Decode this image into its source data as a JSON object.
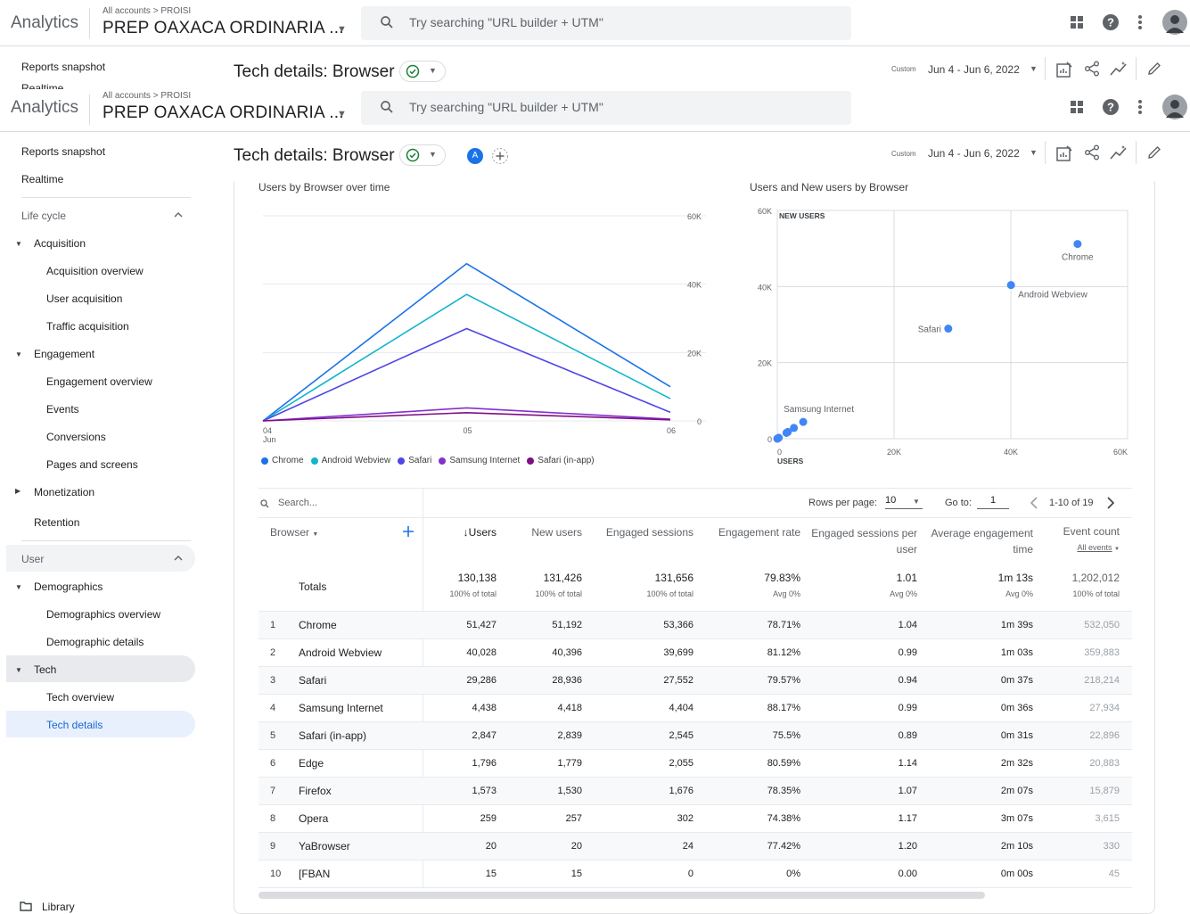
{
  "header": {
    "logo": "Analytics",
    "breadcrumb": "All accounts > PROISI",
    "property": "PREP OAXACA ORDINARIA ...",
    "search_placeholder": "Try searching \"URL builder + UTM\""
  },
  "icons": [
    "search-icon",
    "apps-grid-icon",
    "help-icon",
    "more-vert-icon",
    "avatar",
    "customize-report-icon",
    "share-icon",
    "insights-icon",
    "edit-icon",
    "check-circle-icon",
    "folder-icon"
  ],
  "sidebar_partial_label": "Realtime",
  "toolbar": {
    "title": "Tech details: Browser",
    "custom_label": "Custom",
    "date_range": "Jun 4 - Jun 6, 2022",
    "comparison_badge": "A"
  },
  "sidebar": {
    "reports_snapshot": "Reports snapshot",
    "realtime": "Realtime",
    "life_cycle": "Life cycle",
    "acquisition": "Acquisition",
    "acquisition_overview": "Acquisition overview",
    "user_acquisition": "User acquisition",
    "traffic_acquisition": "Traffic acquisition",
    "engagement": "Engagement",
    "engagement_overview": "Engagement overview",
    "events": "Events",
    "conversions": "Conversions",
    "pages_and_screens": "Pages and screens",
    "monetization": "Monetization",
    "retention": "Retention",
    "user": "User",
    "demographics": "Demographics",
    "demographics_overview": "Demographics overview",
    "demographic_details": "Demographic details",
    "tech": "Tech",
    "tech_overview": "Tech overview",
    "tech_details": "Tech details",
    "library": "Library"
  },
  "chart_data": [
    {
      "type": "line",
      "title": "Users by Browser over time",
      "x": [
        "04\nJun",
        "05",
        "06"
      ],
      "ylim": [
        0,
        60000
      ],
      "y_ticks": [
        "60K",
        "40K",
        "20K",
        "0"
      ],
      "legend_position": "bottom",
      "series": [
        {
          "name": "Chrome",
          "color": "#1a73e8",
          "values": [
            0,
            46000,
            10000
          ]
        },
        {
          "name": "Android Webview",
          "color": "#12b5cb",
          "values": [
            0,
            37000,
            6500
          ]
        },
        {
          "name": "Safari",
          "color": "#4f46e5",
          "values": [
            0,
            27000,
            2500
          ]
        },
        {
          "name": "Samsung Internet",
          "color": "#8430ce",
          "values": [
            0,
            3800,
            500
          ]
        },
        {
          "name": "Safari (in-app)",
          "color": "#7e0e86",
          "values": [
            0,
            2400,
            300
          ]
        }
      ]
    },
    {
      "type": "scatter",
      "title": "Users and New users by Browser",
      "xlabel": "USERS",
      "ylabel": "NEW USERS",
      "xlim": [
        0,
        60000
      ],
      "ylim": [
        0,
        60000
      ],
      "x_ticks": [
        "0",
        "20K",
        "40K",
        "60K"
      ],
      "y_ticks": [
        "60K",
        "40K",
        "20K",
        "0"
      ],
      "points": [
        {
          "label": "Chrome",
          "x": 51427,
          "y": 51192
        },
        {
          "label": "Android Webview",
          "x": 40028,
          "y": 40396
        },
        {
          "label": "Safari",
          "x": 29286,
          "y": 28936
        },
        {
          "label": "Samsung Internet",
          "x": 4438,
          "y": 4418
        },
        {
          "label": "",
          "x": 2847,
          "y": 2839
        },
        {
          "label": "",
          "x": 1796,
          "y": 1779
        },
        {
          "label": "",
          "x": 1573,
          "y": 1530
        },
        {
          "label": "",
          "x": 259,
          "y": 257
        },
        {
          "label": "",
          "x": 20,
          "y": 20
        },
        {
          "label": "",
          "x": 15,
          "y": 15
        }
      ]
    }
  ],
  "table": {
    "search_placeholder": "Search...",
    "rows_per_page_label": "Rows per page:",
    "rows_per_page": "10",
    "goto_label": "Go to:",
    "goto_value": "1",
    "page_info": "1-10 of 19",
    "dimension_header": "Browser",
    "columns": [
      "↓Users",
      "New users",
      "Engaged sessions",
      "Engagement rate",
      "Engaged sessions per user",
      "Average engagement time",
      "Event count"
    ],
    "event_count_sub": "All events",
    "totals": {
      "label": "Totals",
      "values": [
        "130,138",
        "131,426",
        "131,656",
        "79.83%",
        "1.01",
        "1m 13s",
        "1,202,012"
      ],
      "subs": [
        "100% of total",
        "100% of total",
        "100% of total",
        "Avg 0%",
        "Avg 0%",
        "Avg 0%",
        "100% of total"
      ]
    },
    "rows": [
      {
        "n": "1",
        "name": "Chrome",
        "v": [
          "51,427",
          "51,192",
          "53,366",
          "78.71%",
          "1.04",
          "1m 39s",
          "532,050"
        ]
      },
      {
        "n": "2",
        "name": "Android Webview",
        "v": [
          "40,028",
          "40,396",
          "39,699",
          "81.12%",
          "0.99",
          "1m 03s",
          "359,883"
        ]
      },
      {
        "n": "3",
        "name": "Safari",
        "v": [
          "29,286",
          "28,936",
          "27,552",
          "79.57%",
          "0.94",
          "0m 37s",
          "218,214"
        ]
      },
      {
        "n": "4",
        "name": "Samsung Internet",
        "v": [
          "4,438",
          "4,418",
          "4,404",
          "88.17%",
          "0.99",
          "0m 36s",
          "27,934"
        ]
      },
      {
        "n": "5",
        "name": "Safari (in-app)",
        "v": [
          "2,847",
          "2,839",
          "2,545",
          "75.5%",
          "0.89",
          "0m 31s",
          "22,896"
        ]
      },
      {
        "n": "6",
        "name": "Edge",
        "v": [
          "1,796",
          "1,779",
          "2,055",
          "80.59%",
          "1.14",
          "2m 32s",
          "20,883"
        ]
      },
      {
        "n": "7",
        "name": "Firefox",
        "v": [
          "1,573",
          "1,530",
          "1,676",
          "78.35%",
          "1.07",
          "2m 07s",
          "15,879"
        ]
      },
      {
        "n": "8",
        "name": "Opera",
        "v": [
          "259",
          "257",
          "302",
          "74.38%",
          "1.17",
          "3m 07s",
          "3,615"
        ]
      },
      {
        "n": "9",
        "name": "YaBrowser",
        "v": [
          "20",
          "20",
          "24",
          "77.42%",
          "1.20",
          "2m 10s",
          "330"
        ]
      },
      {
        "n": "10",
        "name": "[FBAN",
        "v": [
          "15",
          "15",
          "0",
          "0%",
          "0.00",
          "0m 00s",
          "45"
        ]
      }
    ]
  }
}
